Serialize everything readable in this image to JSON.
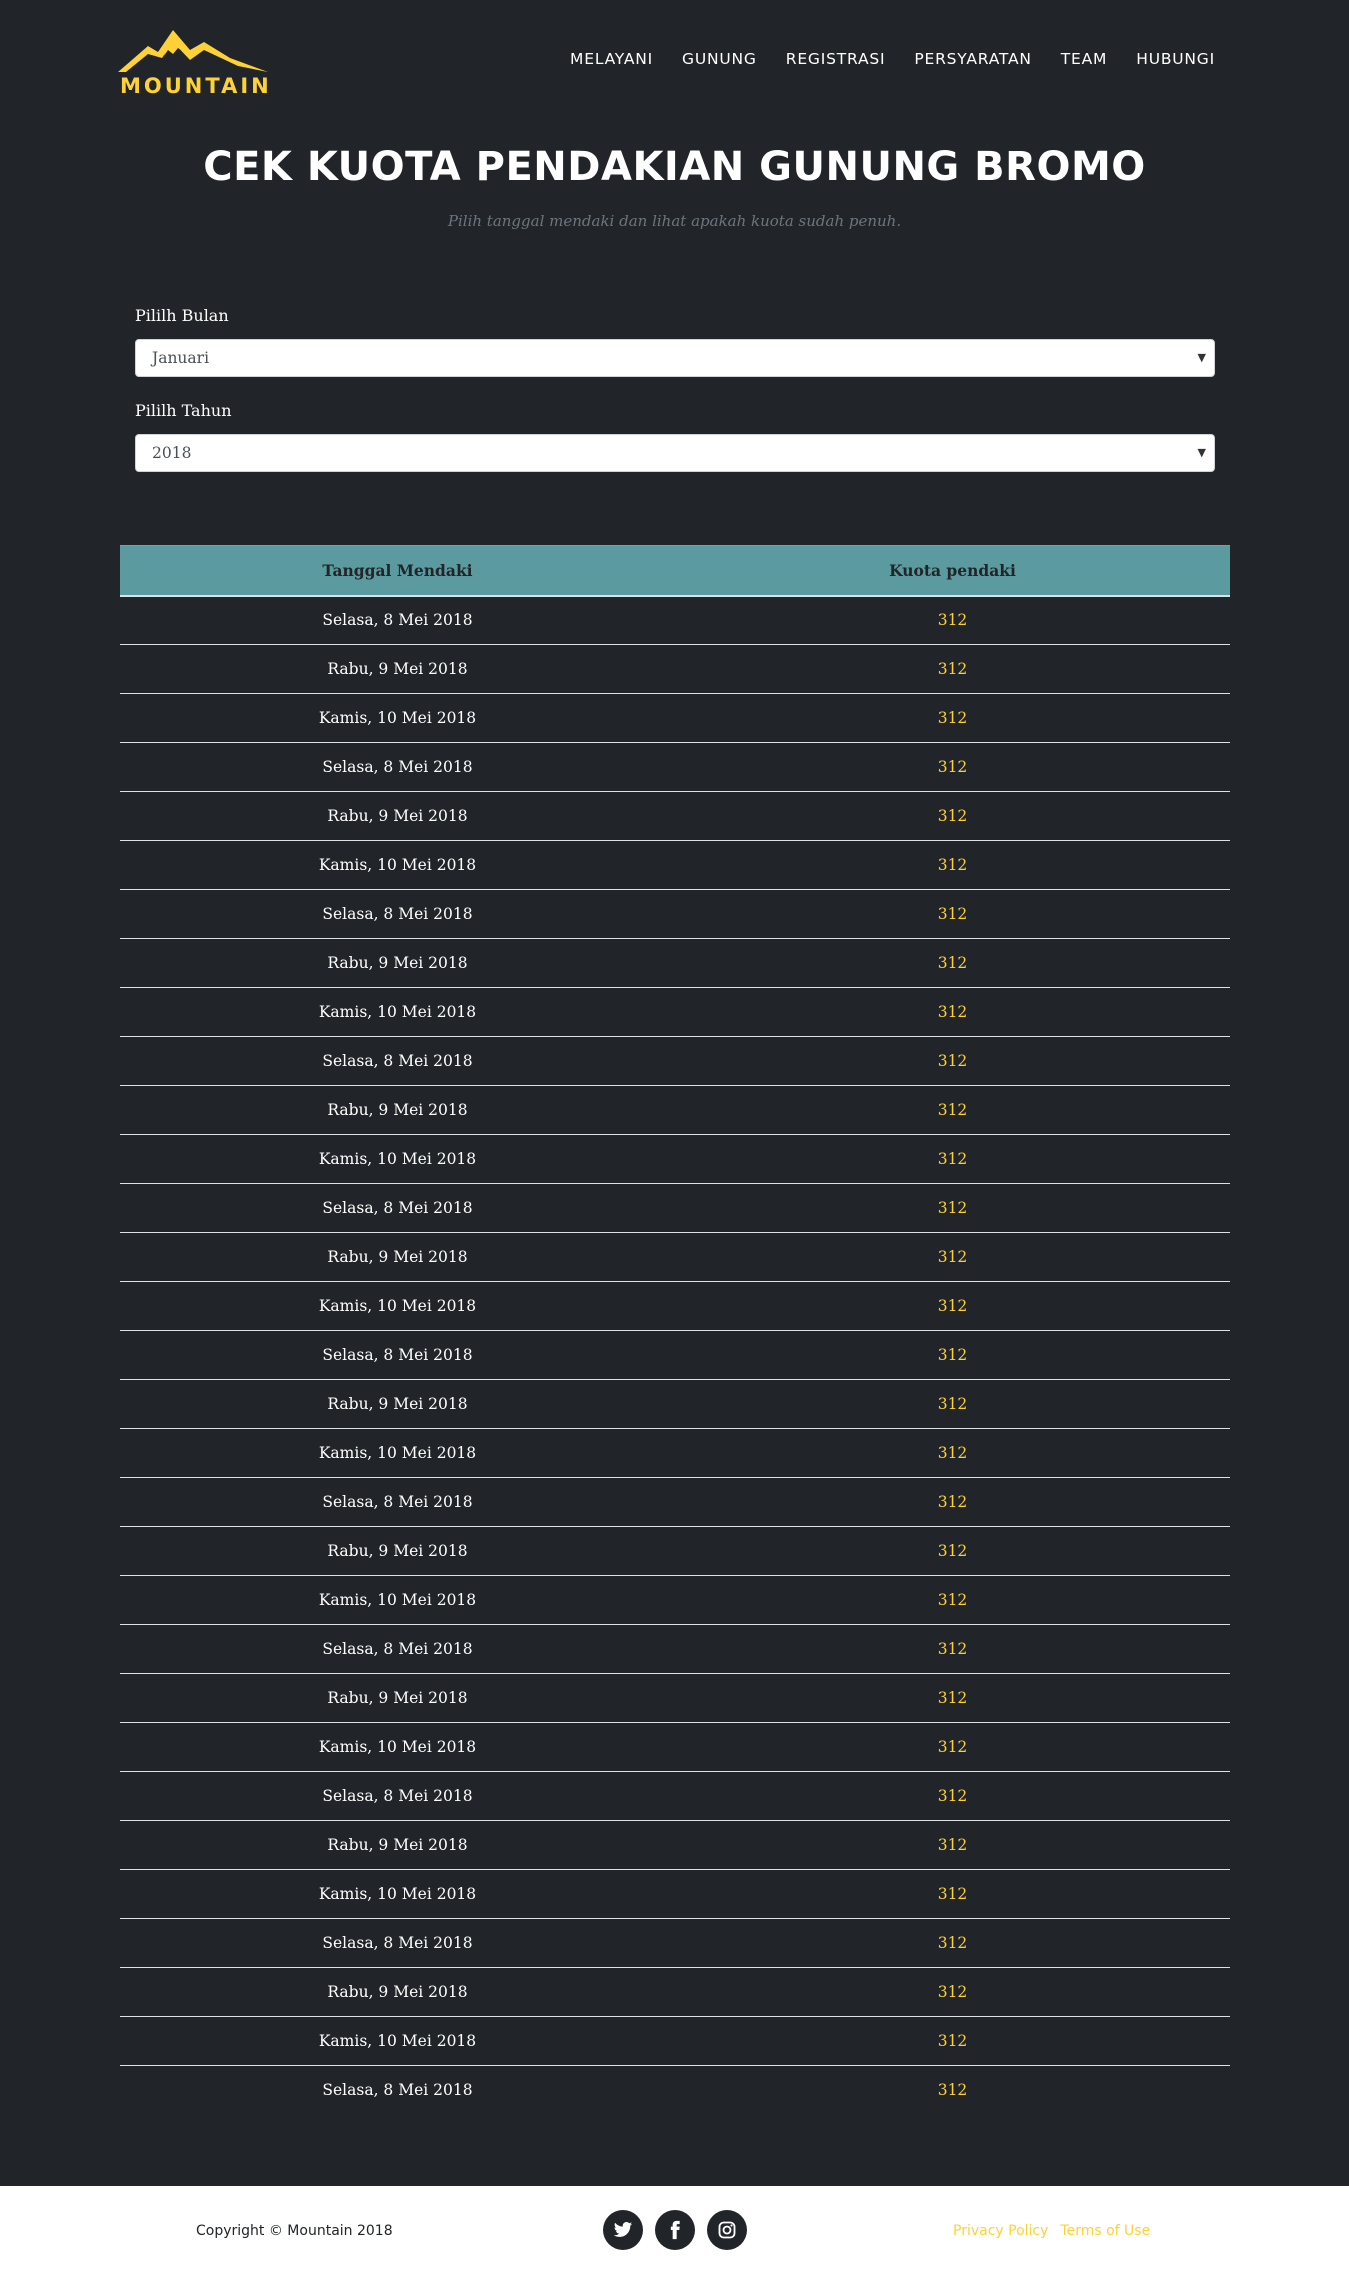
{
  "brand": {
    "name": "MOUNTAIN",
    "accent": "#fed136",
    "background": "#212529",
    "table_header_bg": "#5b9a9e"
  },
  "nav": {
    "items": [
      "MELAYANI",
      "GUNUNG",
      "REGISTRASI",
      "PERSYARATAN",
      "TEAM",
      "HUBUNGI"
    ]
  },
  "header": {
    "title": "CEK KUOTA PENDAKIAN GUNUNG BROMO",
    "subtitle": "Pilih tanggal mendaki dan lihat apakah kuota sudah penuh."
  },
  "form": {
    "month_label": "Pililh Bulan",
    "month_value": "Januari",
    "year_label": "Pililh Tahun",
    "year_value": "2018"
  },
  "table": {
    "headers": [
      "Tanggal Mendaki",
      "Kuota pendaki"
    ],
    "rows": [
      [
        "Selasa, 8 Mei 2018",
        "312"
      ],
      [
        "Rabu, 9 Mei 2018",
        "312"
      ],
      [
        "Kamis, 10 Mei 2018",
        "312"
      ],
      [
        "Selasa, 8 Mei 2018",
        "312"
      ],
      [
        "Rabu, 9 Mei 2018",
        "312"
      ],
      [
        "Kamis, 10 Mei 2018",
        "312"
      ],
      [
        "Selasa, 8 Mei 2018",
        "312"
      ],
      [
        "Rabu, 9 Mei 2018",
        "312"
      ],
      [
        "Kamis, 10 Mei 2018",
        "312"
      ],
      [
        "Selasa, 8 Mei 2018",
        "312"
      ],
      [
        "Rabu, 9 Mei 2018",
        "312"
      ],
      [
        "Kamis, 10 Mei 2018",
        "312"
      ],
      [
        "Selasa, 8 Mei 2018",
        "312"
      ],
      [
        "Rabu, 9 Mei 2018",
        "312"
      ],
      [
        "Kamis, 10 Mei 2018",
        "312"
      ],
      [
        "Selasa, 8 Mei 2018",
        "312"
      ],
      [
        "Rabu, 9 Mei 2018",
        "312"
      ],
      [
        "Kamis, 10 Mei 2018",
        "312"
      ],
      [
        "Selasa, 8 Mei 2018",
        "312"
      ],
      [
        "Rabu, 9 Mei 2018",
        "312"
      ],
      [
        "Kamis, 10 Mei 2018",
        "312"
      ],
      [
        "Selasa, 8 Mei 2018",
        "312"
      ],
      [
        "Rabu, 9 Mei 2018",
        "312"
      ],
      [
        "Kamis, 10 Mei 2018",
        "312"
      ],
      [
        "Selasa, 8 Mei 2018",
        "312"
      ],
      [
        "Rabu, 9 Mei 2018",
        "312"
      ],
      [
        "Kamis, 10 Mei 2018",
        "312"
      ],
      [
        "Selasa, 8 Mei 2018",
        "312"
      ],
      [
        "Rabu, 9 Mei 2018",
        "312"
      ],
      [
        "Kamis, 10 Mei 2018",
        "312"
      ],
      [
        "Selasa, 8 Mei 2018",
        "312"
      ]
    ]
  },
  "footer": {
    "copyright": "Copyright © Mountain 2018",
    "social": [
      "twitter-icon",
      "facebook-icon",
      "instagram-icon"
    ],
    "links": [
      "Privacy Policy",
      "Terms of Use"
    ]
  }
}
